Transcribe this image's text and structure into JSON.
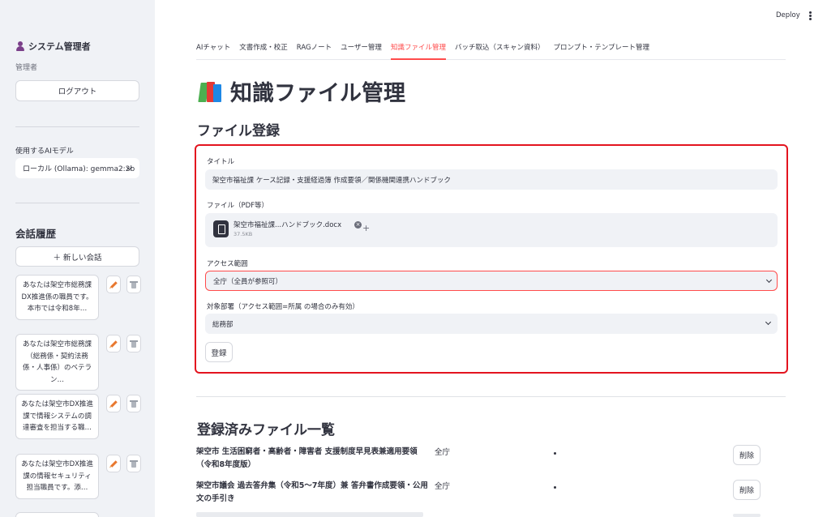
{
  "app": {
    "deploy_label": "Deploy"
  },
  "sidebar": {
    "user_name": "システム管理者",
    "role": "管理者",
    "logout_label": "ログアウト",
    "model_label": "使用するAIモデル",
    "model_value": "ローカル (Ollama): gemma2:2b",
    "history_title": "会話履歴",
    "new_chat_label": "＋ 新しい会話",
    "conversations": [
      "あなたは架空市総務課DX推進係の職員です。本市では令和8年…",
      "あなたは架空市総務課（総務係・契約法務係・人事係）のベテラン…",
      "あなたは架空市DX推進課で情報システムの調達審査を担当する職…",
      "あなたは架空市DX推進課の情報セキュリティ担当職員です。添…"
    ]
  },
  "tabs": [
    {
      "label": "AIチャット",
      "active": false
    },
    {
      "label": "文書作成・校正",
      "active": false
    },
    {
      "label": "RAGノート",
      "active": false
    },
    {
      "label": "ユーザー管理",
      "active": false
    },
    {
      "label": "知識ファイル管理",
      "active": true
    },
    {
      "label": "バッチ取込（スキャン資料）",
      "active": false
    },
    {
      "label": "プロンプト・テンプレート管理",
      "active": false
    }
  ],
  "page": {
    "title": "知識ファイル管理",
    "title_icon": "books-icon"
  },
  "form": {
    "section_title": "ファイル登録",
    "title_label": "タイトル",
    "title_value": "架空市福祉課 ケース記録・支援経過簿 作成要領／関係機関連携ハンドブック",
    "file_label": "ファイル（PDF等）",
    "file_name": "架空市福祉課...ハンドブック.docx",
    "file_size": "37.5KB",
    "scope_label": "アクセス範囲",
    "scope_value": "全庁（全員が参照可）",
    "dept_label": "対象部署（アクセス範囲=所属 の場合のみ有効）",
    "dept_value": "総務部",
    "submit_label": "登録"
  },
  "files": {
    "section_title": "登録済みファイル一覧",
    "delete_label": "削除",
    "rows": [
      {
        "title": "架空市 生活困窮者・高齢者・障害者 支援制度早見表兼適用要領（令和8年度版）",
        "scope": "全庁"
      },
      {
        "title": "架空市議会 過去答弁集（令和5〜7年度）兼 答弁書作成要領・公用文の手引き",
        "scope": "全庁"
      }
    ]
  }
}
